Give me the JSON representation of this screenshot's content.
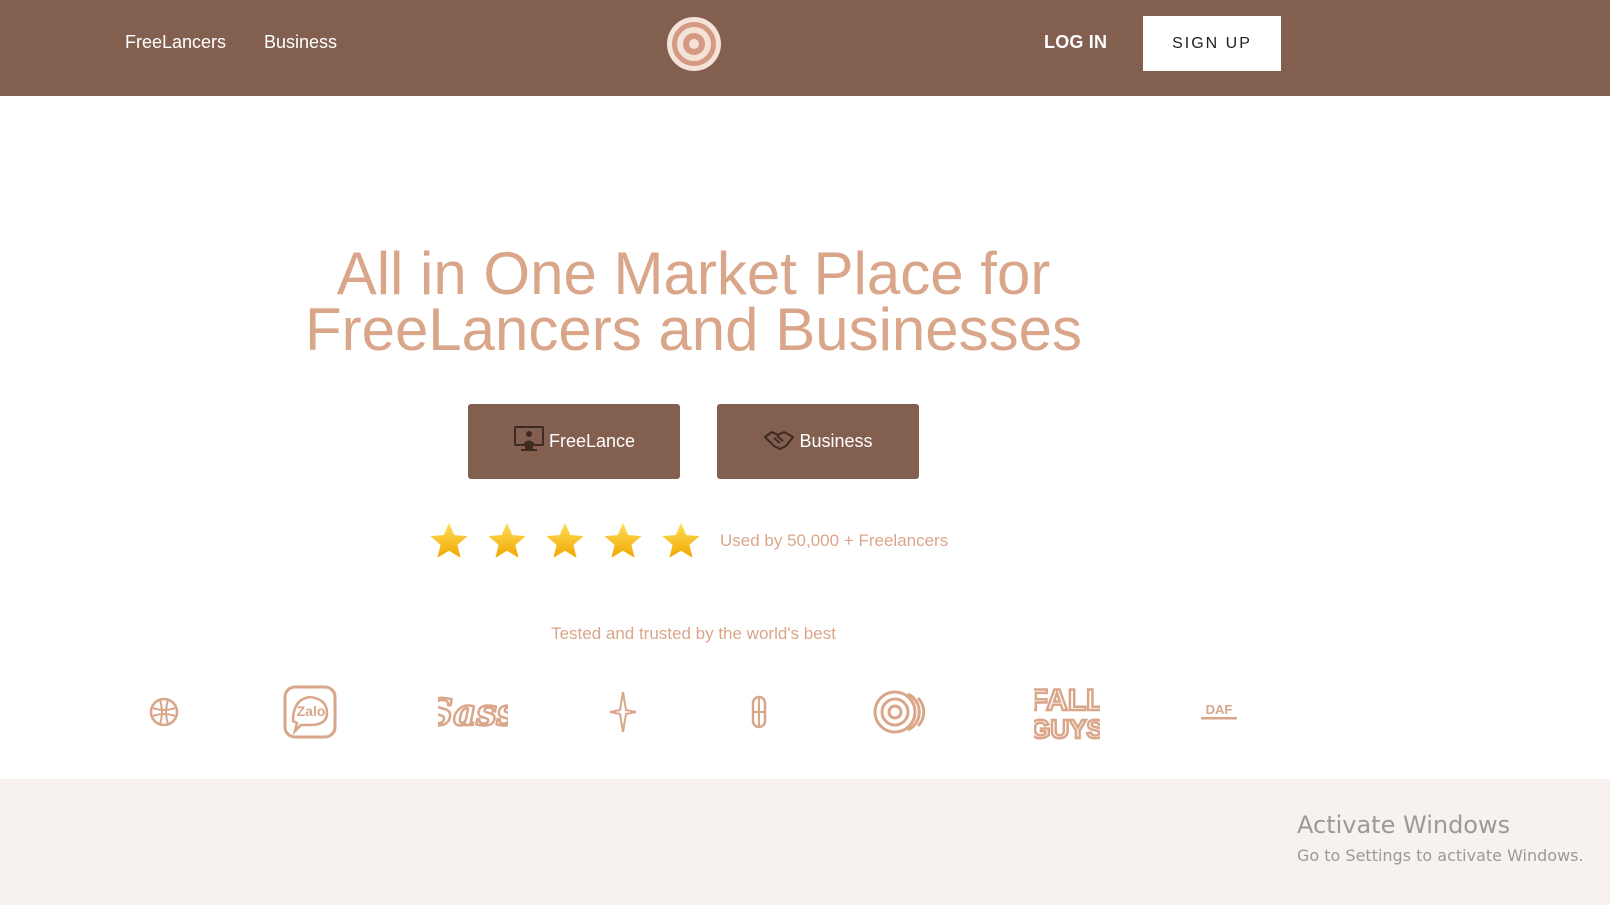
{
  "nav": {
    "links": [
      "FreeLancers",
      "Business"
    ],
    "login_label": "LOG IN",
    "signup_label": "SIGN UP",
    "logo_icon": "target-logo-icon"
  },
  "hero": {
    "headline_line1": "All in One Market Place for",
    "headline_line2": "FreeLancers and Businesses",
    "buttons": [
      {
        "label": "FreeLance",
        "icon": "monitor-person-icon"
      },
      {
        "label": "Business",
        "icon": "handshake-icon"
      }
    ],
    "rating_stars": 5,
    "used_by_text": "Used by 50,000 + Freelancers"
  },
  "trusted": {
    "heading": "Tested and trusted by the world's best",
    "brand_text": {
      "zalo": "Zalo",
      "sass": "Sass",
      "fallguys_top": "FALL",
      "fallguys_bottom": "GUYS",
      "daf": "DAF"
    },
    "brand_icons": [
      "dribbble-icon",
      "zalo-icon",
      "sass-icon",
      "sparkle-icon",
      "lincoln-icon",
      "concentric-icon",
      "fall-guys-icon",
      "daf-icon"
    ]
  },
  "colors": {
    "brand_brown": "#835f4f",
    "accent_peach": "#daa68a",
    "footer_bg": "#f7f2ef"
  },
  "overlay": {
    "activate_title": "Activate Windows",
    "activate_sub": "Go to Settings to activate Windows."
  }
}
